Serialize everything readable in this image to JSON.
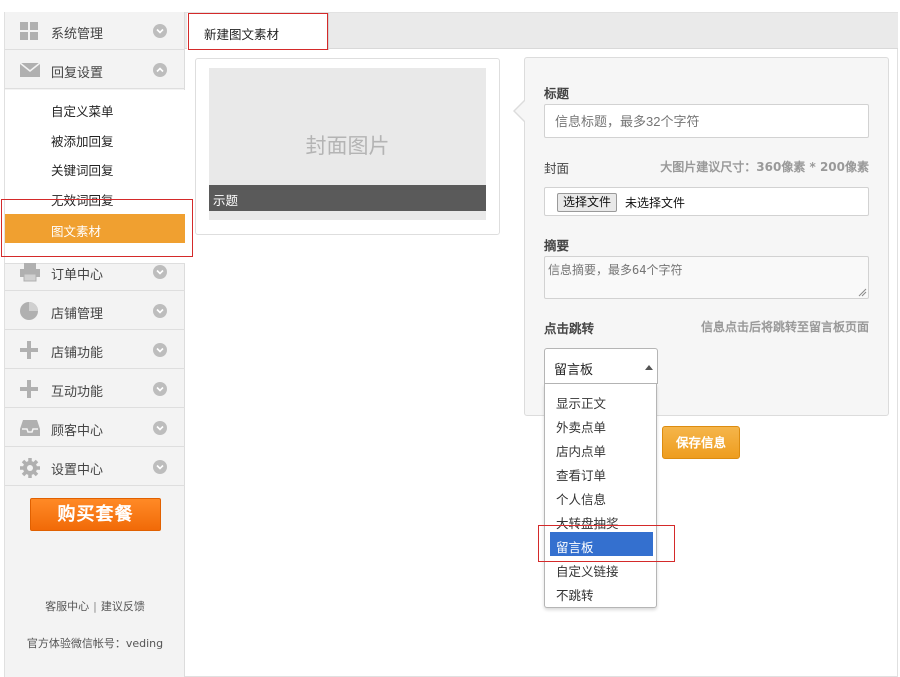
{
  "sidebar": {
    "top_items": [
      {
        "label": "系统管理",
        "icon": "grid-icon",
        "expanded": false
      },
      {
        "label": "回复设置",
        "icon": "envelope-icon",
        "expanded": true
      }
    ],
    "submenu": [
      {
        "label": "自定义菜单"
      },
      {
        "label": "被添加回复"
      },
      {
        "label": "关键词回复"
      },
      {
        "label": "无效词回复"
      },
      {
        "label": "图文素材",
        "active": true
      }
    ],
    "bottom_items": [
      {
        "label": "订单中心",
        "icon": "printer-icon"
      },
      {
        "label": "店铺管理",
        "icon": "pie-chart-icon"
      },
      {
        "label": "店铺功能",
        "icon": "plus-icon"
      },
      {
        "label": "互动功能",
        "icon": "plus-icon"
      },
      {
        "label": "顾客中心",
        "icon": "inbox-icon"
      },
      {
        "label": "设置中心",
        "icon": "gear-icon"
      }
    ],
    "buy_button": "购买套餐",
    "footer": {
      "service": "客服中心",
      "separator": "|",
      "feedback": "建议反馈"
    },
    "official_account": "官方体验微信帐号：veding"
  },
  "tabs": [
    {
      "label": "新建图文素材"
    }
  ],
  "preview": {
    "cover_placeholder": "封面图片",
    "title_text": "示题"
  },
  "form": {
    "title_label": "标题",
    "title_placeholder": "信息标题，最多32个字符",
    "cover_label": "封面",
    "cover_hint": "大图片建议尺寸：360像素 * 200像素",
    "file_button": "选择文件",
    "file_status": "未选择文件",
    "summary_label": "摘要",
    "summary_placeholder": "信息摘要，最多64个字符",
    "jump_label": "点击跳转",
    "jump_hint": "信息点击后将跳转至留言板页面",
    "jump_selected": "留言板",
    "jump_options": [
      "显示正文",
      "外卖点单",
      "店内点单",
      "查看订单",
      "个人信息",
      "大转盘抽奖",
      "留言板",
      "自定义链接",
      "不跳转"
    ],
    "save_button": "保存信息"
  },
  "colors": {
    "accent": "#f0a030",
    "selection": "#3470cf",
    "highlight_box": "#d42a2a",
    "buy_button": "#f37a10"
  }
}
